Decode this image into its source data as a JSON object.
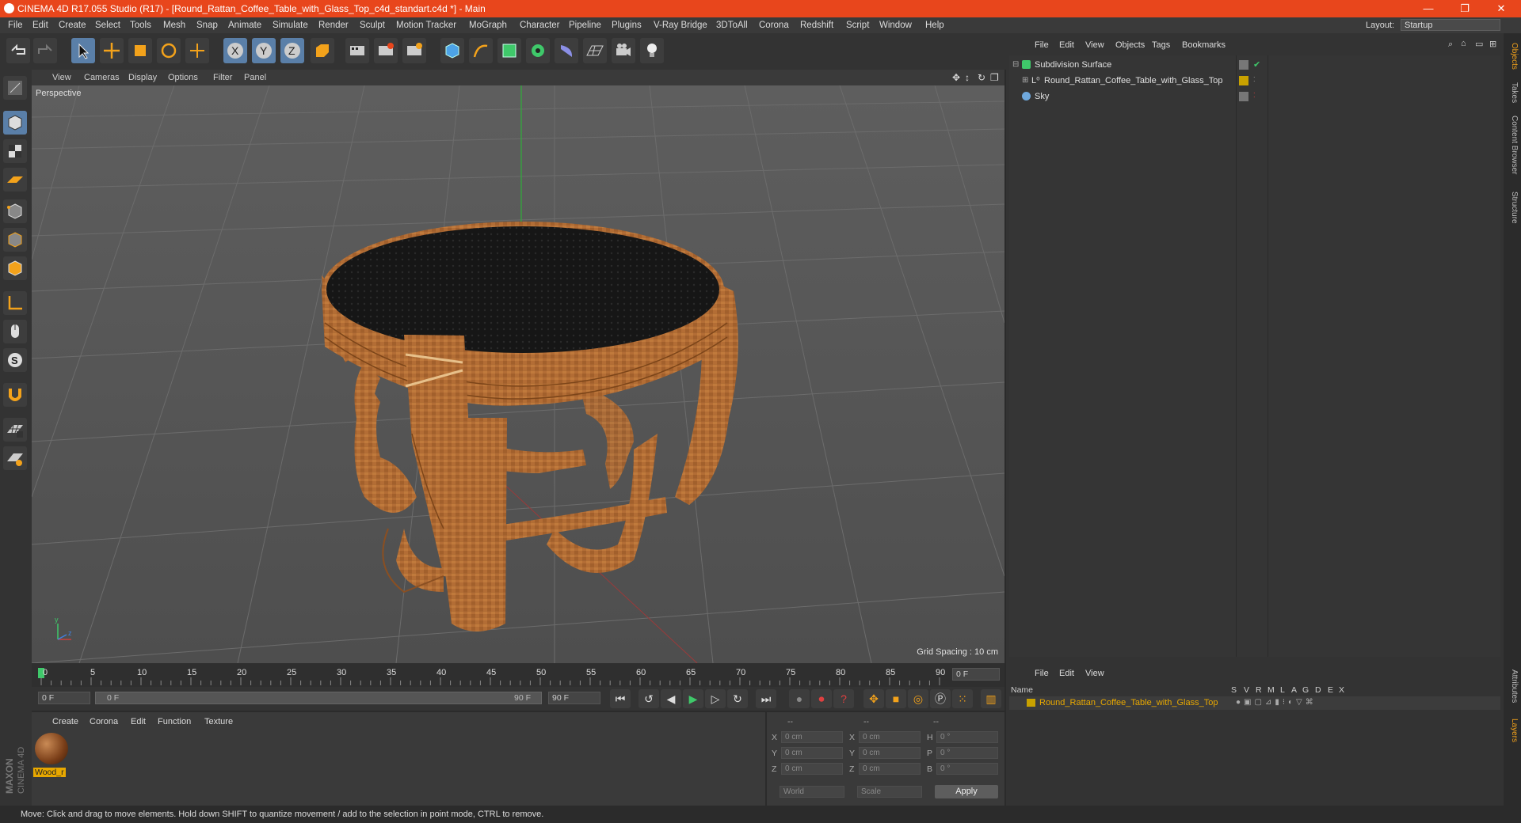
{
  "window": {
    "title": "CINEMA 4D R17.055 Studio (R17) - [Round_Rattan_Coffee_Table_with_Glass_Top_c4d_standart.c4d *] - Main",
    "minimize": "—",
    "restore": "❐",
    "close": "✕"
  },
  "menu": {
    "items": [
      "File",
      "Edit",
      "Create",
      "Select",
      "Tools",
      "Mesh",
      "Snap",
      "Animate",
      "Simulate",
      "Render",
      "Sculpt",
      "Motion Tracker",
      "MoGraph",
      "Character",
      "Pipeline",
      "Plugins",
      "V-Ray Bridge",
      "3DToAll",
      "Corona",
      "Redshift",
      "Script",
      "Window",
      "Help"
    ],
    "layout_label": "Layout:",
    "layout_value": "Startup"
  },
  "viewport": {
    "menu": [
      "View",
      "Cameras",
      "Display",
      "Options",
      "Filter",
      "Panel"
    ],
    "label": "Perspective",
    "grid_spacing": "Grid Spacing : 10 cm"
  },
  "timeline": {
    "ticks": [
      "0",
      "5",
      "10",
      "15",
      "20",
      "25",
      "30",
      "35",
      "40",
      "45",
      "50",
      "55",
      "60",
      "65",
      "70",
      "75",
      "80",
      "85",
      "90"
    ],
    "current_frame": "0 F",
    "start_frame": "0 F",
    "range_start": "0 F",
    "range_end": "90 F",
    "end_frame": "90 F"
  },
  "material_manager": {
    "menu": [
      "Create",
      "Corona",
      "Edit",
      "Function",
      "Texture"
    ],
    "material_name": "Wood_r"
  },
  "coordinates": {
    "headers": [
      "--",
      "--",
      "--"
    ],
    "rows": [
      {
        "l1": "X",
        "v1": "0 cm",
        "l2": "X",
        "v2": "0 cm",
        "l3": "H",
        "v3": "0 °"
      },
      {
        "l1": "Y",
        "v1": "0 cm",
        "l2": "Y",
        "v2": "0 cm",
        "l3": "P",
        "v3": "0 °"
      },
      {
        "l1": "Z",
        "v1": "0 cm",
        "l2": "Z",
        "v2": "0 cm",
        "l3": "B",
        "v3": "0 °"
      }
    ],
    "world": "World",
    "scale": "Scale",
    "apply": "Apply"
  },
  "object_manager": {
    "menu": [
      "File",
      "Edit",
      "View",
      "Objects",
      "Tags",
      "Bookmarks"
    ],
    "objects": [
      "Subdivision Surface",
      "Round_Rattan_Coffee_Table_with_Glass_Top",
      "Sky"
    ]
  },
  "layer_manager": {
    "menu": [
      "File",
      "Edit",
      "View"
    ],
    "columns": [
      "Name",
      "S",
      "V",
      "R",
      "M",
      "L",
      "A",
      "G",
      "D",
      "E",
      "X"
    ],
    "layer_name": "Round_Rattan_Coffee_Table_with_Glass_Top"
  },
  "right_tabs": [
    "Objects",
    "Takes",
    "Content Browser",
    "Structure",
    "Attributes",
    "Layers"
  ],
  "brand": "MAXON CINEMA 4D",
  "status": "Move: Click and drag to move elements. Hold down SHIFT to quantize movement / add to the selection in point mode, CTRL to remove.",
  "colors": {
    "titlebar": "#e8461c",
    "selected_tool": "#5a7fa8",
    "layer_color": "#c9a200",
    "highlight_text": "#e8a800"
  }
}
